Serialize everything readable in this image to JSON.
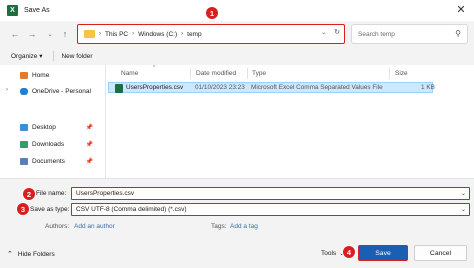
{
  "window": {
    "title": "Save As",
    "app_icon_letter": "X"
  },
  "nav": {
    "back_icon": "arrow-left-icon",
    "forward_icon": "arrow-right-icon",
    "recent_icon": "chevron-down-icon",
    "up_icon": "arrow-up-icon",
    "breadcrumbs": [
      "This PC",
      "Windows (C:)",
      "temp"
    ],
    "search_placeholder": "Search temp"
  },
  "toolbar": {
    "organize": "Organize",
    "organize_arrow": "▾",
    "new_folder": "New folder"
  },
  "sidebar": {
    "items": [
      {
        "label": "Home",
        "icon": "home-icon"
      },
      {
        "label": "OneDrive - Personal",
        "icon": "cloud-icon"
      },
      {
        "label": "Desktop",
        "icon": "desktop-icon"
      },
      {
        "label": "Downloads",
        "icon": "download-icon"
      },
      {
        "label": "Documents",
        "icon": "document-icon"
      }
    ]
  },
  "columns": {
    "name": "Name",
    "date": "Date modified",
    "type": "Type",
    "size": "Size"
  },
  "files": [
    {
      "name": "UsersProperties.csv",
      "date": "01/10/2023 23:23",
      "type": "Microsoft Excel Comma Separated Values File",
      "size": "1 KB"
    }
  ],
  "form": {
    "filename_label": "File name:",
    "filename_value": "UsersProperties.csv",
    "savetype_label": "Save as type:",
    "savetype_value": "CSV UTF-8 (Comma delimited) (*.csv)",
    "authors_label": "Authors:",
    "authors_value": "Add an author",
    "tags_label": "Tags:",
    "tags_value": "Add a tag"
  },
  "footer": {
    "hide_folders": "Hide Folders",
    "tools": "Tools",
    "save": "Save",
    "cancel": "Cancel"
  },
  "badges": [
    "1",
    "2",
    "3",
    "4"
  ],
  "colors": {
    "highlight": "#d81e1e",
    "primary_button": "#1a5fb4",
    "selection": "#cce8ff",
    "excel_green": "#1d6f42"
  }
}
